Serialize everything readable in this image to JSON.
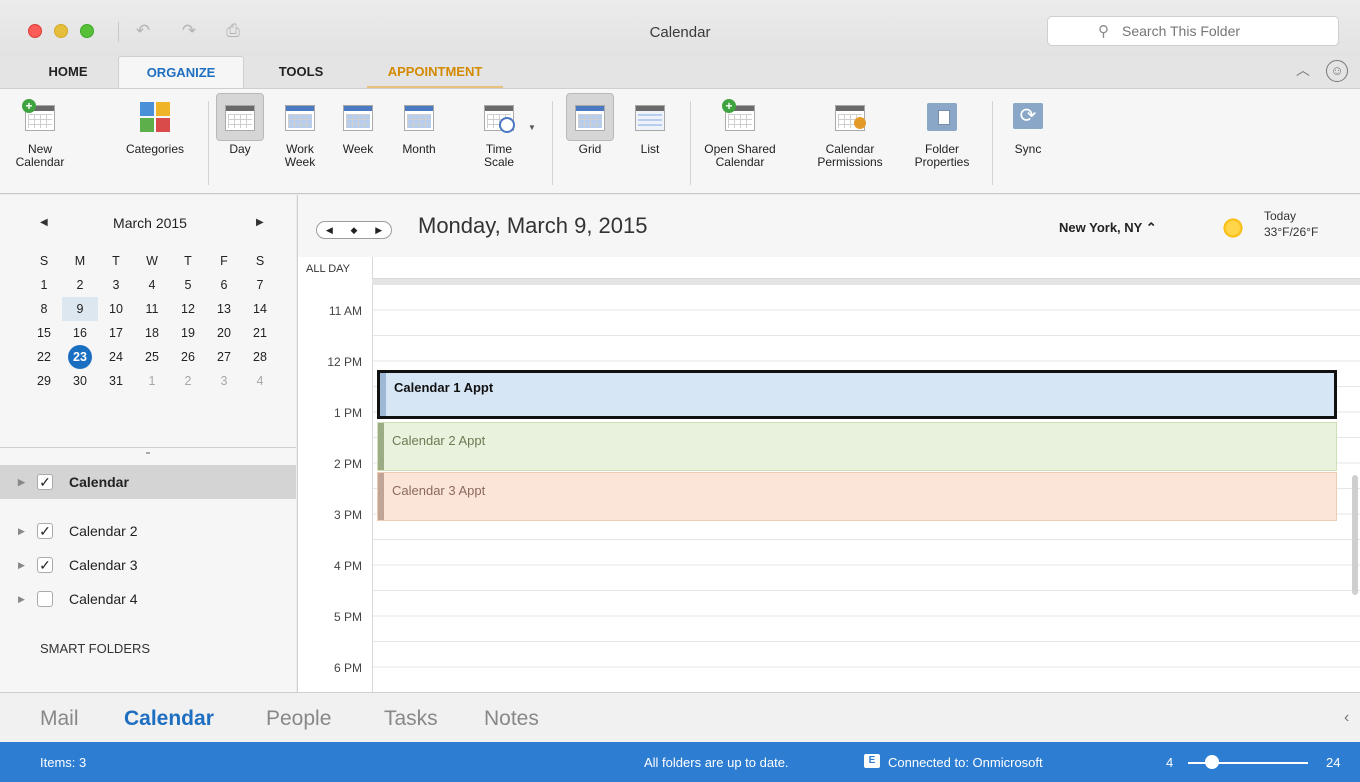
{
  "window": {
    "title": "Calendar",
    "search_placeholder": "Search This Folder"
  },
  "tabs": [
    {
      "label": "HOME"
    },
    {
      "label": "ORGANIZE"
    },
    {
      "label": "TOOLS"
    },
    {
      "label": "APPOINTMENT"
    }
  ],
  "ribbon": {
    "new_calendar": "New Calendar",
    "categories": "Categories",
    "day": "Day",
    "work_week": "Work Week",
    "week": "Week",
    "month": "Month",
    "time_scale": "Time Scale",
    "grid": "Grid",
    "list": "List",
    "open_shared_calendar": "Open Shared Calendar",
    "calendar_permissions": "Calendar Permissions",
    "folder_properties": "Folder Properties",
    "sync": "Sync"
  },
  "mini_calendar": {
    "title": "March 2015",
    "weekdays": [
      "S",
      "M",
      "T",
      "W",
      "T",
      "F",
      "S"
    ],
    "weeks": [
      [
        "1",
        "2",
        "3",
        "4",
        "5",
        "6",
        "7"
      ],
      [
        "8",
        "9",
        "10",
        "11",
        "12",
        "13",
        "14"
      ],
      [
        "15",
        "16",
        "17",
        "18",
        "19",
        "20",
        "21"
      ],
      [
        "22",
        "23",
        "24",
        "25",
        "26",
        "27",
        "28"
      ],
      [
        "29",
        "30",
        "31",
        "1",
        "2",
        "3",
        "4"
      ]
    ],
    "selected_day": "9",
    "today": "23"
  },
  "folders": {
    "items": [
      {
        "label": "Calendar",
        "checked": true
      },
      {
        "label": "Calendar 2",
        "checked": true
      },
      {
        "label": "Calendar 3",
        "checked": true
      },
      {
        "label": "Calendar 4",
        "checked": false
      }
    ],
    "smart_folders": "SMART FOLDERS",
    "check_mark": "✓"
  },
  "day_view": {
    "title": "Monday, March 9, 2015",
    "location": "New York, NY",
    "weather_label": "Today",
    "weather_temp": "33°F/26°F",
    "all_day_label": "ALL DAY",
    "hours": [
      "11 AM",
      "12 PM",
      "1 PM",
      "2 PM",
      "3 PM",
      "4 PM",
      "5 PM",
      "6 PM"
    ],
    "appointments": [
      {
        "title": "Calendar 1 Appt"
      },
      {
        "title": "Calendar 2 Appt"
      },
      {
        "title": "Calendar 3 Appt"
      }
    ]
  },
  "nav": {
    "items": [
      "Mail",
      "Calendar",
      "People",
      "Tasks",
      "Notes"
    ],
    "active": "Calendar"
  },
  "status": {
    "items": "Items: 3",
    "sync_status": "All folders are up to date.",
    "connection": "Connected to: Onmicrosoft",
    "zoom_min": "4",
    "zoom_max": "24",
    "zoom_level": 0.2
  },
  "colors": {
    "accent": "#1e6fc1",
    "status_bar": "#2d7dd2",
    "appointment_tab": "#d38a00"
  }
}
